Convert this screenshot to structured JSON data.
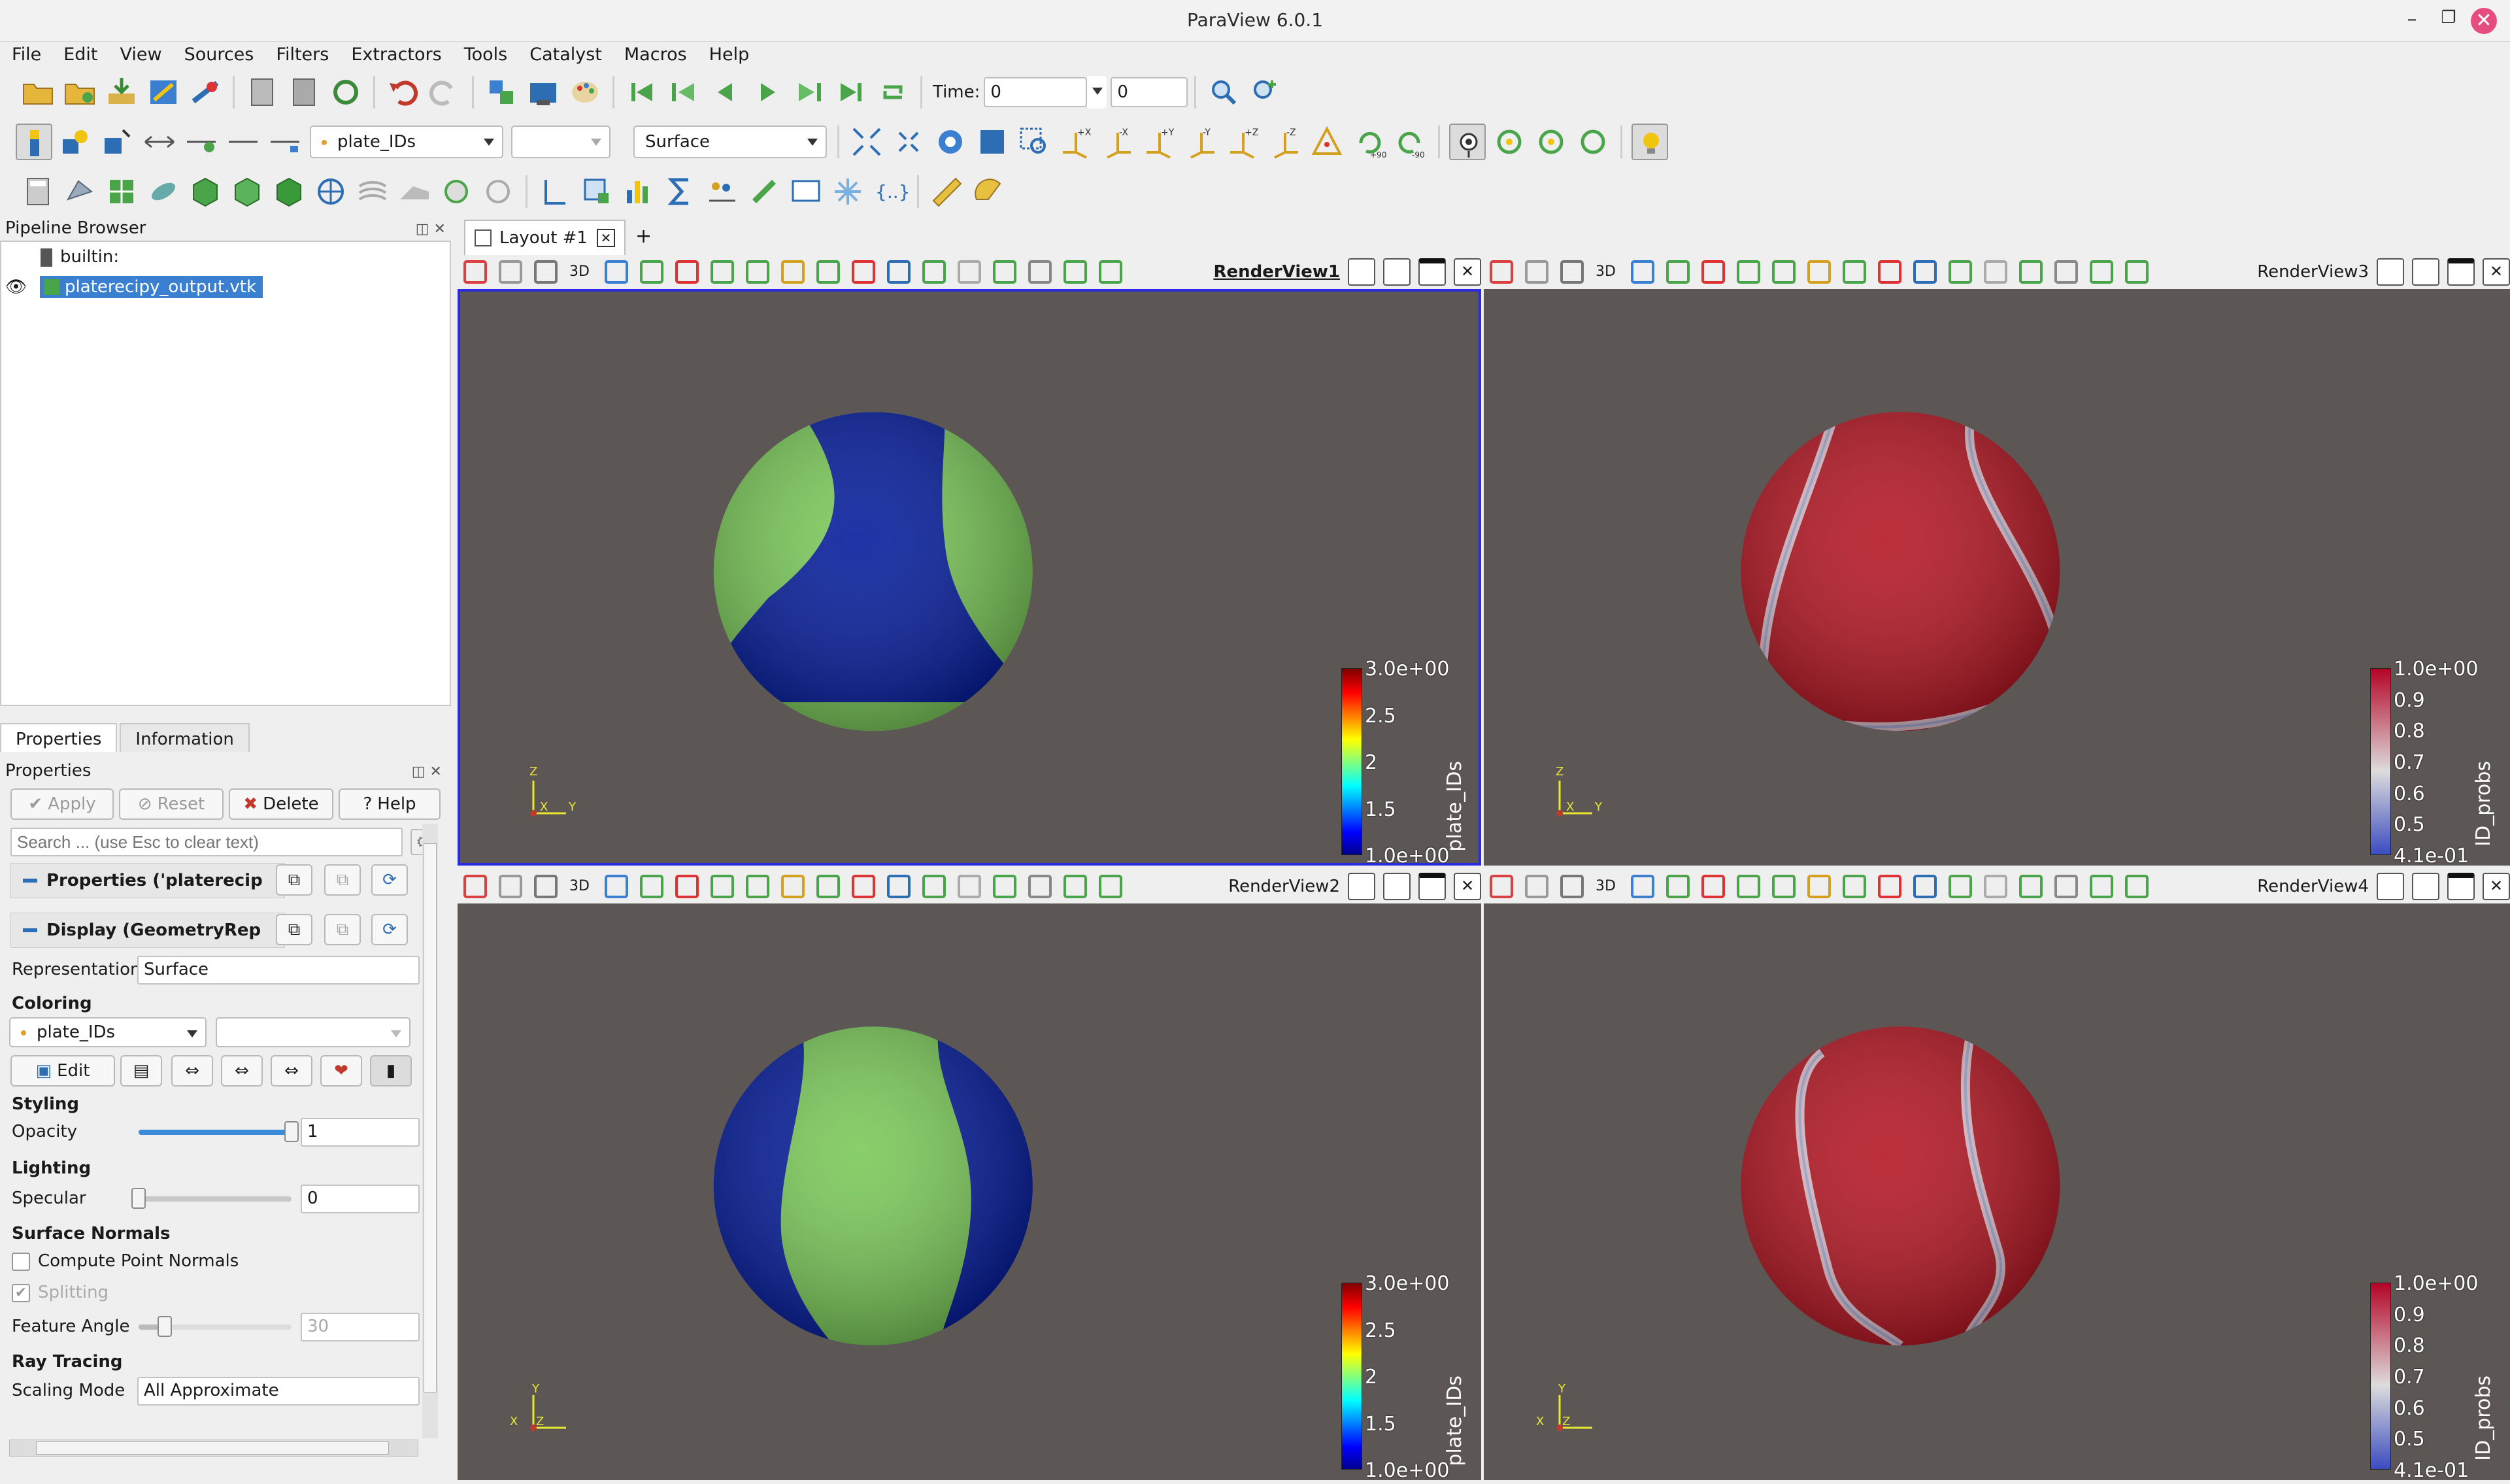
{
  "window": {
    "title": "ParaView 6.0.1"
  },
  "menu": [
    "File",
    "Edit",
    "View",
    "Sources",
    "Filters",
    "Extractors",
    "Tools",
    "Catalyst",
    "Macros",
    "Help"
  ],
  "toolbar": {
    "time_label": "Time:",
    "time_value": "0",
    "time_step": "0",
    "array_combo": "plate_IDs",
    "component_combo": "",
    "representation_combo": "Surface"
  },
  "pipeline": {
    "header": "Pipeline Browser",
    "root": "builtin:",
    "item": "platerecipy_output.vtk"
  },
  "tabs": {
    "properties": "Properties",
    "information": "Information"
  },
  "props": {
    "header": "Properties",
    "apply": "Apply",
    "reset": "Reset",
    "delete": "Delete",
    "help": "Help",
    "search_placeholder": "Search ... (use Esc to clear text)",
    "sec_properties": "Properties ('platerecip",
    "sec_display": "Display (GeometryRep",
    "representation_label": "Representation",
    "representation_value": "Surface",
    "coloring": "Coloring",
    "coloring_value": "plate_IDs",
    "edit": "Edit",
    "styling": "Styling",
    "opacity_label": "Opacity",
    "opacity_value": "1",
    "lighting": "Lighting",
    "specular_label": "Specular",
    "specular_value": "0",
    "surface_normals": "Surface Normals",
    "compute_normals": "Compute Point Normals",
    "splitting": "Splitting",
    "feature_angle_label": "Feature Angle",
    "feature_angle_value": "30",
    "ray_tracing": "Ray Tracing",
    "scaling_mode_label": "Scaling Mode",
    "scaling_mode_value": "All Approximate",
    "opacity_fraction": 1.0,
    "specular_fraction": 0.0,
    "feature_angle_fraction": 0.17
  },
  "layout": {
    "tab": "Layout #1",
    "plus": "+"
  },
  "views": [
    {
      "name": "RenderView1",
      "colorbar_title": "plate_IDs",
      "labels": [
        "3.0e+00",
        "2.5",
        "2",
        "1.5",
        "1.0e+00"
      ]
    },
    {
      "name": "RenderView3",
      "colorbar_title": "ID_probs",
      "labels": [
        "1.0e+00",
        "0.9",
        "0.8",
        "0.7",
        "0.6",
        "0.5",
        "4.1e-01"
      ]
    },
    {
      "name": "RenderView2",
      "colorbar_title": "plate_IDs",
      "labels": [
        "3.0e+00",
        "2.5",
        "2",
        "1.5",
        "1.0e+00"
      ]
    },
    {
      "name": "RenderView4",
      "colorbar_title": "ID_probs",
      "labels": [
        "1.0e+00",
        "0.9",
        "0.8",
        "0.7",
        "0.6",
        "0.5",
        "4.1e-01"
      ]
    }
  ],
  "axis_labels": {
    "x": "X",
    "y": "Y",
    "z": "Z"
  },
  "view_toolbar": {
    "mode": "3D"
  },
  "colors": {
    "accent": "#2a2ae0",
    "view_bg": "#5c5654",
    "green": "#78c856",
    "blue": "#00189a",
    "red": "#b3121f"
  }
}
